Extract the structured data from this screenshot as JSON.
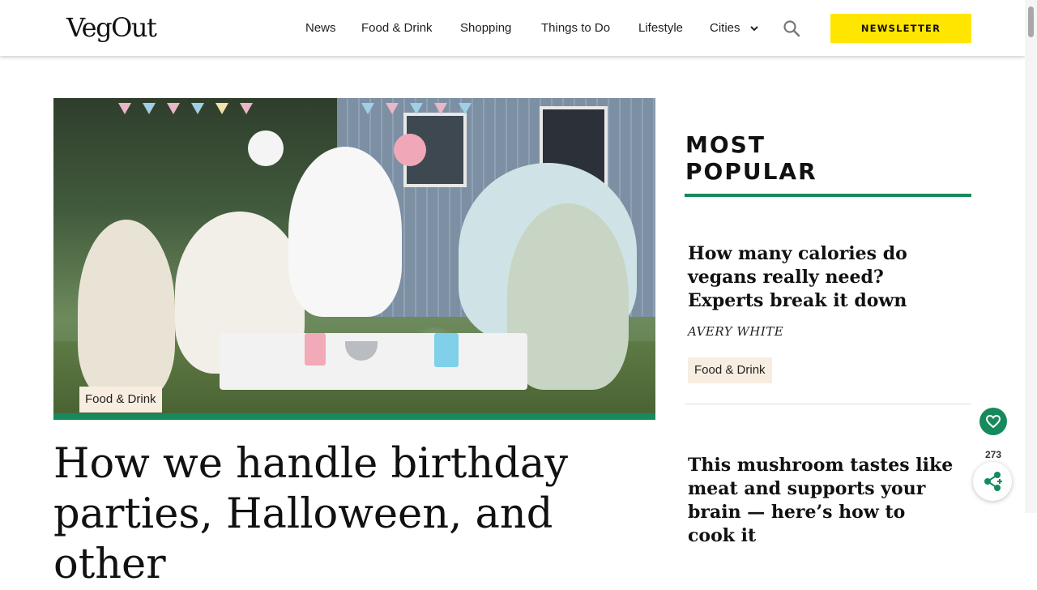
{
  "header": {
    "logo": "VegOut",
    "nav": [
      "News",
      "Food & Drink",
      "Shopping",
      "Things to Do",
      "Lifestyle",
      "Cities"
    ],
    "newsletter_label": "NEWSLETTER"
  },
  "hero": {
    "category": "Food & Drink",
    "headline": "How we handle birthday parties, Halloween, and other"
  },
  "most_popular": {
    "title": "MOST POPULAR",
    "items": [
      {
        "title": "How many calories do vegans really need? Experts break it down",
        "author": "AVERY WHITE",
        "category": "Food & Drink"
      },
      {
        "title": "This mushroom tastes like meat and supports your brain — here’s how to cook it"
      }
    ]
  },
  "share": {
    "count": "273"
  },
  "colors": {
    "accent": "#168a5c",
    "newsletter": "#ffe600",
    "tag_bg": "#f7ede0"
  },
  "icons": [
    "chevron-down-icon",
    "search-icon",
    "heart-icon",
    "share-icon"
  ]
}
